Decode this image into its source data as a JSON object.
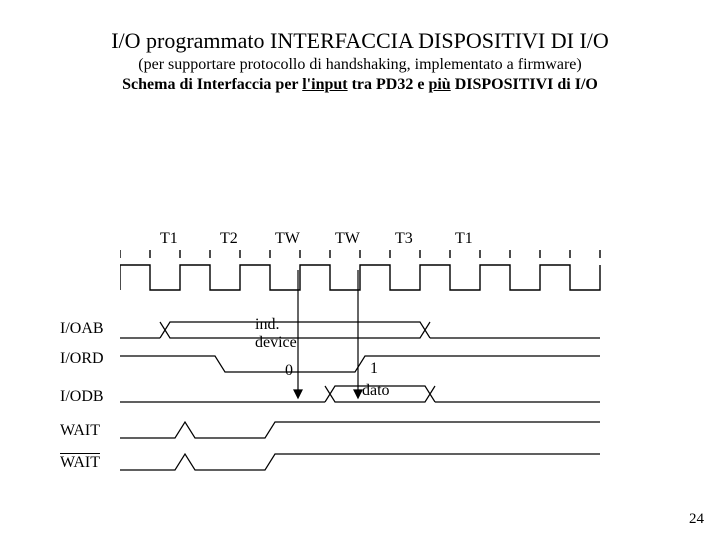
{
  "title": "I/O programmato INTERFACCIA DISPOSITIVI DI I/O",
  "subtitle1": "(per supportare protocollo di handshaking, implementato a firmware)",
  "subtitle2_pre": "Schema di Interfaccia per ",
  "subtitle2_u1": "l'input",
  "subtitle2_mid": " tra PD32 e ",
  "subtitle2_u2": "più",
  "subtitle2_post": " DISPOSITIVI di I/O",
  "clock": {
    "labels": [
      "T1",
      "T2",
      "TW",
      "TW",
      "T3",
      "T1"
    ]
  },
  "signals": {
    "ioab": {
      "name": "I/OAB",
      "ann": "ind. device"
    },
    "iord": {
      "name": "I/ORD",
      "ann0": "0",
      "ann1": "1"
    },
    "iodb": {
      "name": "I/ODB",
      "ann": "dato"
    },
    "wait": {
      "name": "WAIT"
    },
    "wait_bar": {
      "name": "WAIT"
    }
  },
  "page_num": "24"
}
